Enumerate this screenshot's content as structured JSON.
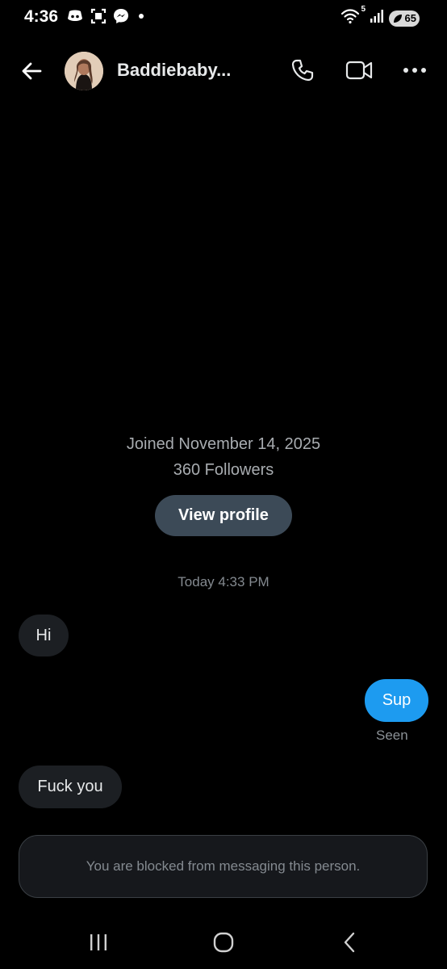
{
  "status_bar": {
    "time": "4:36",
    "wifi_superscript": "5",
    "battery": "65",
    "icons": [
      "discord-icon",
      "screenshot-icon",
      "messenger-icon",
      "notification-dot",
      "wifi-icon",
      "signal-icon",
      "battery-icon"
    ]
  },
  "header": {
    "title": "Baddiebaby...",
    "icons": [
      "back-arrow-icon",
      "avatar",
      "phone-icon",
      "video-camera-icon",
      "more-horizontal-icon"
    ]
  },
  "profile": {
    "joined": "Joined November 14, 2025",
    "followers": "360 Followers",
    "view_profile_label": "View profile"
  },
  "conversation": {
    "timestamp": "Today 4:33 PM",
    "messages": [
      {
        "direction": "incoming",
        "text": "Hi"
      },
      {
        "direction": "outgoing",
        "text": "Sup",
        "status": "Seen"
      },
      {
        "direction": "incoming",
        "text": "Fuck you"
      }
    ]
  },
  "blocked_notice": "You are blocked from messaging this person.",
  "colors": {
    "background": "#000000",
    "accent": "#1d9bf0",
    "incoming_bubble": "#1c1f23",
    "view_profile_button": "#3c4a57"
  },
  "nav_bar": {
    "icons": [
      "recents-icon",
      "home-icon",
      "nav-back-icon"
    ]
  }
}
